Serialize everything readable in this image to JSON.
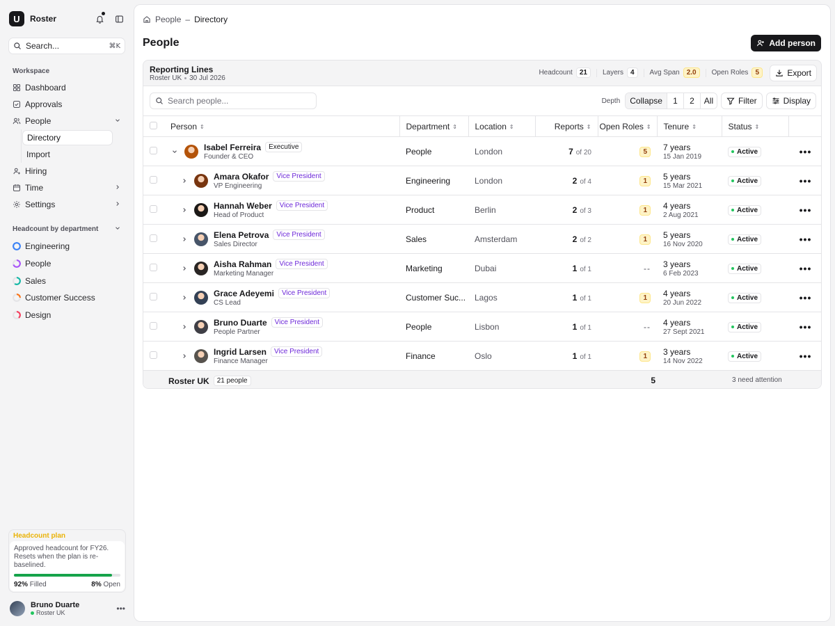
{
  "app": {
    "name": "Roster",
    "logo_letter": "U"
  },
  "sidebar": {
    "search_label": "Search...",
    "search_shortcut": "⌘K",
    "workspace_label": "Workspace",
    "nav": [
      {
        "label": "Dashboard",
        "icon": "dashboard-icon"
      },
      {
        "label": "Approvals",
        "icon": "approvals-icon"
      },
      {
        "label": "People",
        "icon": "people-icon"
      },
      {
        "label": "Hiring",
        "icon": "hiring-icon"
      },
      {
        "label": "Time",
        "icon": "calendar-icon"
      },
      {
        "label": "Settings",
        "icon": "gear-icon"
      }
    ],
    "people_sub": [
      {
        "label": "Directory",
        "active": true
      },
      {
        "label": "Import"
      }
    ],
    "dept_label": "Headcount by department",
    "departments": [
      {
        "label": "Engineering",
        "color": "#3b82f6",
        "fill": 1.0
      },
      {
        "label": "People",
        "color": "#a855f7",
        "fill": 0.7
      },
      {
        "label": "Sales",
        "color": "#14b8a6",
        "fill": 0.6
      },
      {
        "label": "Customer Success",
        "color": "#f97316",
        "fill": 0.25
      },
      {
        "label": "Design",
        "color": "#f43f5e",
        "fill": 0.4
      }
    ],
    "plan": {
      "title": "Headcount plan",
      "description": "Approved headcount for FY26. Resets when the plan is re-baselined.",
      "filled_pct": "92%",
      "filled_label": "Filled",
      "open_pct": "8%",
      "open_label": "Open",
      "filled_fraction": 0.92
    },
    "user": {
      "name": "Bruno Duarte",
      "org": "Roster UK"
    }
  },
  "breadcrumb": {
    "parent": "People",
    "current": "Directory"
  },
  "page": {
    "title": "People",
    "add_button": "Add person"
  },
  "card": {
    "title": "Reporting Lines",
    "org": "Roster UK",
    "date": "30 Jul 2026",
    "stats": [
      {
        "label": "Headcount",
        "value": "21",
        "tone": "neutral"
      },
      {
        "label": "Layers",
        "value": "4",
        "tone": "neutral"
      },
      {
        "label": "Avg Span",
        "value": "2.0",
        "tone": "amber"
      },
      {
        "label": "Open Roles",
        "value": "5",
        "tone": "amber"
      }
    ],
    "export_label": "Export"
  },
  "toolbar": {
    "search_placeholder": "Search people...",
    "depth_label": "Depth",
    "depth_options": [
      "Collapse",
      "1",
      "2",
      "All"
    ],
    "filter_label": "Filter",
    "display_label": "Display"
  },
  "table": {
    "columns": [
      "Person",
      "Department",
      "Location",
      "Reports",
      "Open Roles",
      "Tenure",
      "Status"
    ],
    "rows": [
      {
        "name": "Isabel Ferreira",
        "role": "Executive",
        "title": "Founder & CEO",
        "department": "People",
        "location": "London",
        "reports": "7",
        "reports_of": "of 20",
        "open": "5",
        "tenure": "7 years",
        "since": "15 Jan 2019",
        "status": "Active",
        "expanded": true,
        "avatar": "#b45309"
      },
      {
        "name": "Amara Okafor",
        "role": "Vice President",
        "title": "VP Engineering",
        "department": "Engineering",
        "location": "London",
        "reports": "2",
        "reports_of": "of 4",
        "open": "1",
        "tenure": "5 years",
        "since": "15 Mar 2021",
        "status": "Active",
        "avatar": "#78350f"
      },
      {
        "name": "Hannah Weber",
        "role": "Vice President",
        "title": "Head of Product",
        "department": "Product",
        "location": "Berlin",
        "reports": "2",
        "reports_of": "of 3",
        "open": "1",
        "tenure": "4 years",
        "since": "2 Aug 2021",
        "status": "Active",
        "avatar": "#1c1917"
      },
      {
        "name": "Elena Petrova",
        "role": "Vice President",
        "title": "Sales Director",
        "department": "Sales",
        "location": "Amsterdam",
        "reports": "2",
        "reports_of": "of 2",
        "open": "1",
        "tenure": "5 years",
        "since": "16 Nov 2020",
        "status": "Active",
        "avatar": "#475569"
      },
      {
        "name": "Aisha Rahman",
        "role": "Vice President",
        "title": "Marketing Manager",
        "department": "Marketing",
        "location": "Dubai",
        "reports": "1",
        "reports_of": "of 1",
        "open": "--",
        "tenure": "3 years",
        "since": "6 Feb 2023",
        "status": "Active",
        "avatar": "#292524"
      },
      {
        "name": "Grace Adeyemi",
        "role": "Vice President",
        "title": "CS Lead",
        "department": "Customer Suc...",
        "location": "Lagos",
        "reports": "1",
        "reports_of": "of 1",
        "open": "1",
        "tenure": "4 years",
        "since": "20 Jun 2022",
        "status": "Active",
        "avatar": "#334155"
      },
      {
        "name": "Bruno Duarte",
        "role": "Vice President",
        "title": "People Partner",
        "department": "People",
        "location": "Lisbon",
        "reports": "1",
        "reports_of": "of 1",
        "open": "--",
        "tenure": "4 years",
        "since": "27 Sept 2021",
        "status": "Active",
        "avatar": "#3f3f46"
      },
      {
        "name": "Ingrid Larsen",
        "role": "Vice President",
        "title": "Finance Manager",
        "department": "Finance",
        "location": "Oslo",
        "reports": "1",
        "reports_of": "of 1",
        "open": "1",
        "tenure": "3 years",
        "since": "14 Nov 2022",
        "status": "Active",
        "avatar": "#57534e"
      }
    ],
    "footer": {
      "org": "Roster UK",
      "count": "21 people",
      "open_total": "5",
      "attention": "3 need attention"
    }
  }
}
